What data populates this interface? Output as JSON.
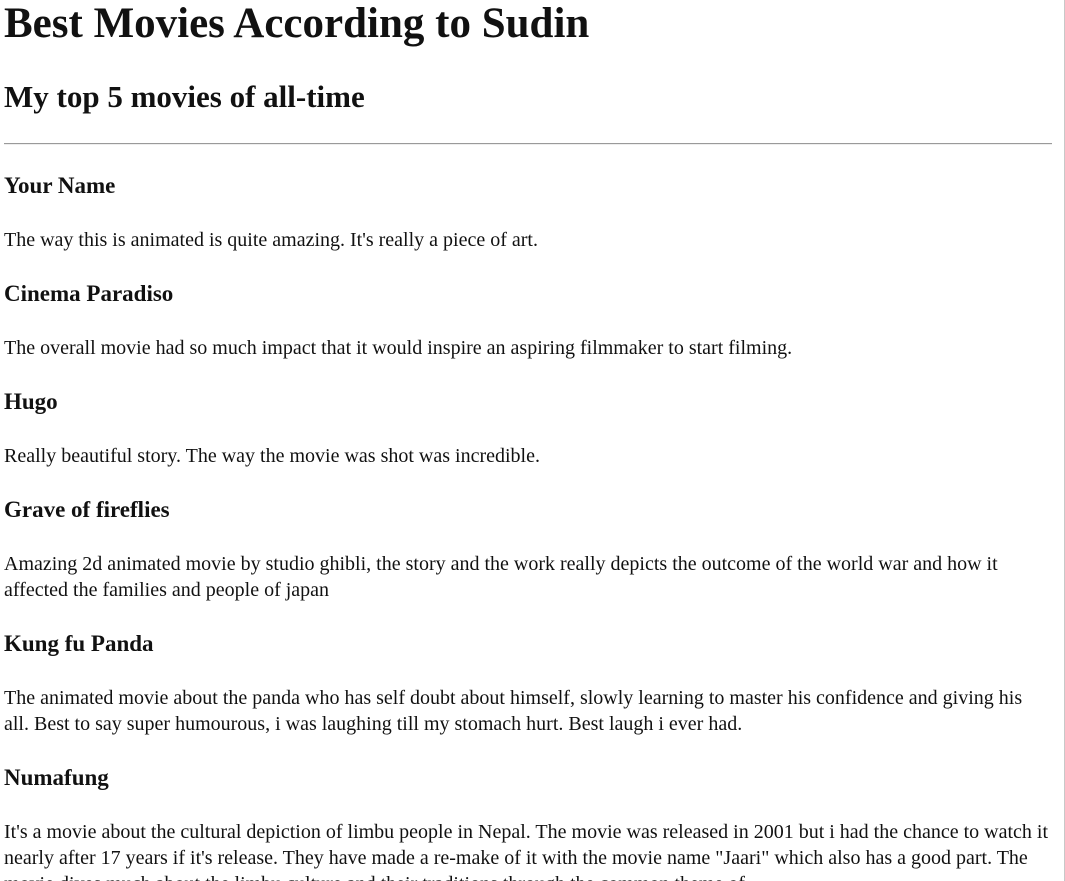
{
  "page": {
    "title": "Best Movies According to Sudin",
    "subtitle": "My top 5 movies of all-time"
  },
  "movies": [
    {
      "title": "Your Name",
      "review": "The way this is animated is quite amazing. It's really a piece of art."
    },
    {
      "title": "Cinema Paradiso",
      "review": "The overall movie had so much impact that it would inspire an aspiring filmmaker to start filming."
    },
    {
      "title": "Hugo",
      "review": "Really beautiful story. The way the movie was shot was incredible."
    },
    {
      "title": "Grave of fireflies",
      "review": "Amazing 2d animated movie by studio ghibli, the story and the work really depicts the outcome of the world war and how it affected the families and people of japan"
    },
    {
      "title": "Kung fu Panda",
      "review": "The animated movie about the panda who has self doubt about himself, slowly learning to master his confidence and giving his all. Best to say super humourous, i was laughing till my stomach hurt. Best laugh i ever had."
    },
    {
      "title": "Numafung",
      "review": "It's a movie about the cultural depiction of limbu people in Nepal. The movie was released in 2001 but i had the chance to watch it nearly after 17 years if it's release. They have made a re-make of it with the movie name \"Jaari\" which also has a good part. The movie dives much about the limbu culture and their traditions through the common theme of"
    }
  ]
}
